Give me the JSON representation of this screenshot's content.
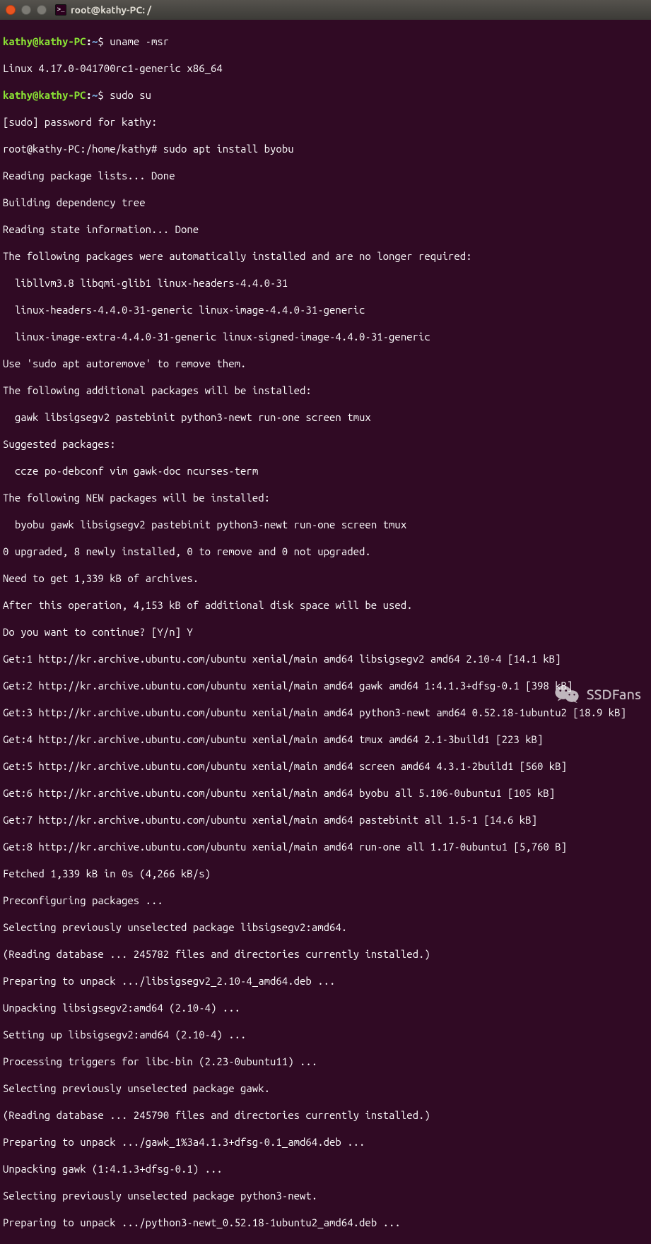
{
  "window": {
    "title": "root@kathy-PC: /"
  },
  "prompt1": {
    "userhost": "kathy@kathy-PC",
    "path": "~",
    "symbol": "$",
    "cmd": "uname -msr"
  },
  "out1": "Linux 4.17.0-041700rc1-generic x86_64",
  "prompt2": {
    "userhost": "kathy@kathy-PC",
    "path": "~",
    "symbol": "$",
    "cmd": "sudo su"
  },
  "out2": "[sudo] password for kathy:",
  "line_rootprompt": "root@kathy-PC:/home/kathy# sudo apt install byobu",
  "apt": {
    "l01": "Reading package lists... Done",
    "l02": "Building dependency tree",
    "l03": "Reading state information... Done",
    "l04": "The following packages were automatically installed and are no longer required:",
    "l05": "  libllvm3.8 libqmi-glib1 linux-headers-4.4.0-31",
    "l06": "  linux-headers-4.4.0-31-generic linux-image-4.4.0-31-generic",
    "l07": "  linux-image-extra-4.4.0-31-generic linux-signed-image-4.4.0-31-generic",
    "l08": "Use 'sudo apt autoremove' to remove them.",
    "l09": "The following additional packages will be installed:",
    "l10": "  gawk libsigsegv2 pastebinit python3-newt run-one screen tmux",
    "l11": "Suggested packages:",
    "l12": "  ccze po-debconf vim gawk-doc ncurses-term",
    "l13": "The following NEW packages will be installed:",
    "l14": "  byobu gawk libsigsegv2 pastebinit python3-newt run-one screen tmux",
    "l15": "0 upgraded, 8 newly installed, 0 to remove and 0 not upgraded.",
    "l16": "Need to get 1,339 kB of archives.",
    "l17": "After this operation, 4,153 kB of additional disk space will be used.",
    "l18": "Do you want to continue? [Y/n] Y",
    "l19": "Get:1 http://kr.archive.ubuntu.com/ubuntu xenial/main amd64 libsigsegv2 amd64 2.10-4 [14.1 kB]",
    "l20": "Get:2 http://kr.archive.ubuntu.com/ubuntu xenial/main amd64 gawk amd64 1:4.1.3+dfsg-0.1 [398 kB]",
    "l21": "Get:3 http://kr.archive.ubuntu.com/ubuntu xenial/main amd64 python3-newt amd64 0.52.18-1ubuntu2 [18.9 kB]",
    "l22": "Get:4 http://kr.archive.ubuntu.com/ubuntu xenial/main amd64 tmux amd64 2.1-3build1 [223 kB]",
    "l23": "Get:5 http://kr.archive.ubuntu.com/ubuntu xenial/main amd64 screen amd64 4.3.1-2build1 [560 kB]",
    "l24": "Get:6 http://kr.archive.ubuntu.com/ubuntu xenial/main amd64 byobu all 5.106-0ubuntu1 [105 kB]",
    "l25": "Get:7 http://kr.archive.ubuntu.com/ubuntu xenial/main amd64 pastebinit all 1.5-1 [14.6 kB]",
    "l26": "Get:8 http://kr.archive.ubuntu.com/ubuntu xenial/main amd64 run-one all 1.17-0ubuntu1 [5,760 B]",
    "l27": "Fetched 1,339 kB in 0s (4,266 kB/s)",
    "l28": "Preconfiguring packages ...",
    "l29": "Selecting previously unselected package libsigsegv2:amd64.",
    "l30": "(Reading database ... 245782 files and directories currently installed.)",
    "l31": "Preparing to unpack .../libsigsegv2_2.10-4_amd64.deb ...",
    "l32": "Unpacking libsigsegv2:amd64 (2.10-4) ...",
    "l33": "Setting up libsigsegv2:amd64 (2.10-4) ...",
    "l34": "Processing triggers for libc-bin (2.23-0ubuntu11) ...",
    "l35": "Selecting previously unselected package gawk.",
    "l36": "(Reading database ... 245790 files and directories currently installed.)",
    "l37": "Preparing to unpack .../gawk_1%3a4.1.3+dfsg-0.1_amd64.deb ...",
    "l38": "Unpacking gawk (1:4.1.3+dfsg-0.1) ...",
    "l39": "Selecting previously unselected package python3-newt.",
    "l40": "Preparing to unpack .../python3-newt_0.52.18-1ubuntu2_amd64.deb ..."
  },
  "watermark": {
    "text": "SSDFans"
  }
}
